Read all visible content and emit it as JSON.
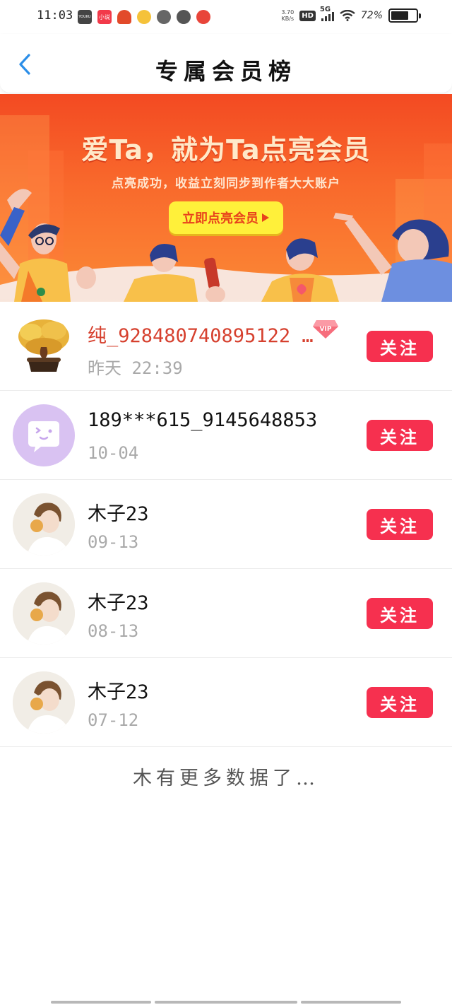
{
  "status_bar": {
    "time": "11:03",
    "app_icons": [
      {
        "label": "YOUKU",
        "color": "#444444"
      },
      {
        "label": "小说",
        "color": "#f23a4a"
      },
      {
        "label": "",
        "color": "#e24a2a"
      },
      {
        "label": "",
        "color": "#f5c23a"
      },
      {
        "label": "",
        "color": "#666666"
      },
      {
        "label": "",
        "color": "#555555"
      },
      {
        "label": "",
        "color": "#e8453a"
      }
    ],
    "net_speed_value": "3.70",
    "net_speed_unit": "KB/s",
    "hd": "HD",
    "network": "5G",
    "battery_percent_text": "72%",
    "battery_level": 0.72
  },
  "header": {
    "back_icon": "chevron-left-icon",
    "title": "专属会员榜",
    "accent_color": "#2b8ee8"
  },
  "banner": {
    "headline": "爱Ta，就为Ta点亮会员",
    "subtitle": "点亮成功，收益立刻同步到作者大大账户",
    "cta_label": "立即点亮会员",
    "cta_icon": "play-triangle-icon"
  },
  "members": [
    {
      "name": "纯_928480740895122 …",
      "time": "昨天  22:39",
      "vip": true,
      "avatar": "money-tree",
      "follow_label": "关注"
    },
    {
      "name": "189***615_9145648853",
      "time": "10-04",
      "vip": false,
      "avatar": "default-chat",
      "follow_label": "关注"
    },
    {
      "name": "木子23",
      "time": "09-13",
      "vip": false,
      "avatar": "person-photo",
      "follow_label": "关注"
    },
    {
      "name": "木子23",
      "time": "08-13",
      "vip": false,
      "avatar": "person-photo",
      "follow_label": "关注"
    },
    {
      "name": "木子23",
      "time": "07-12",
      "vip": false,
      "avatar": "person-photo",
      "follow_label": "关注"
    }
  ],
  "vip_badge_label": "VIP",
  "end_note": "木有更多数据了…",
  "colors": {
    "follow_button": "#f6304f",
    "vip_name": "#d6402e",
    "banner_top": "#f34a22",
    "banner_cta": "#fff03a"
  }
}
